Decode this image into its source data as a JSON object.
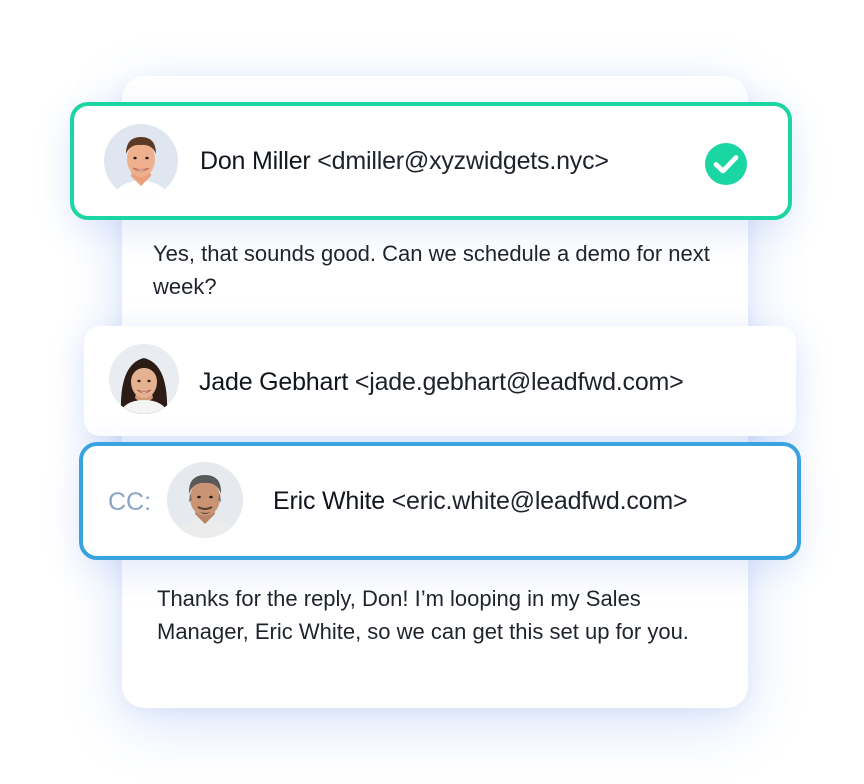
{
  "messages": [
    {
      "contact": {
        "name": "Don Miller",
        "email": "<dmiller@xyzwidgets.nyc>",
        "avatar_icon": "man-avatar",
        "verified_icon": "check-circle-icon",
        "accent_color": "#19d6a2"
      },
      "body": "Yes, that sounds good. Can we schedule a demo for next week?"
    },
    {
      "contact": {
        "name": "Jade Gebhart",
        "email": "<jade.gebhart@leadfwd.com>",
        "avatar_icon": "woman-avatar"
      },
      "cc": {
        "label": "CC:",
        "name": "Eric White",
        "email": "<eric.white@leadfwd.com>",
        "avatar_icon": "man-avatar",
        "accent_color": "#39a3e0"
      },
      "body": "Thanks for the reply, Don! I’m looping in my Sales Manager, Eric White, so we can get this set up for you."
    }
  ]
}
